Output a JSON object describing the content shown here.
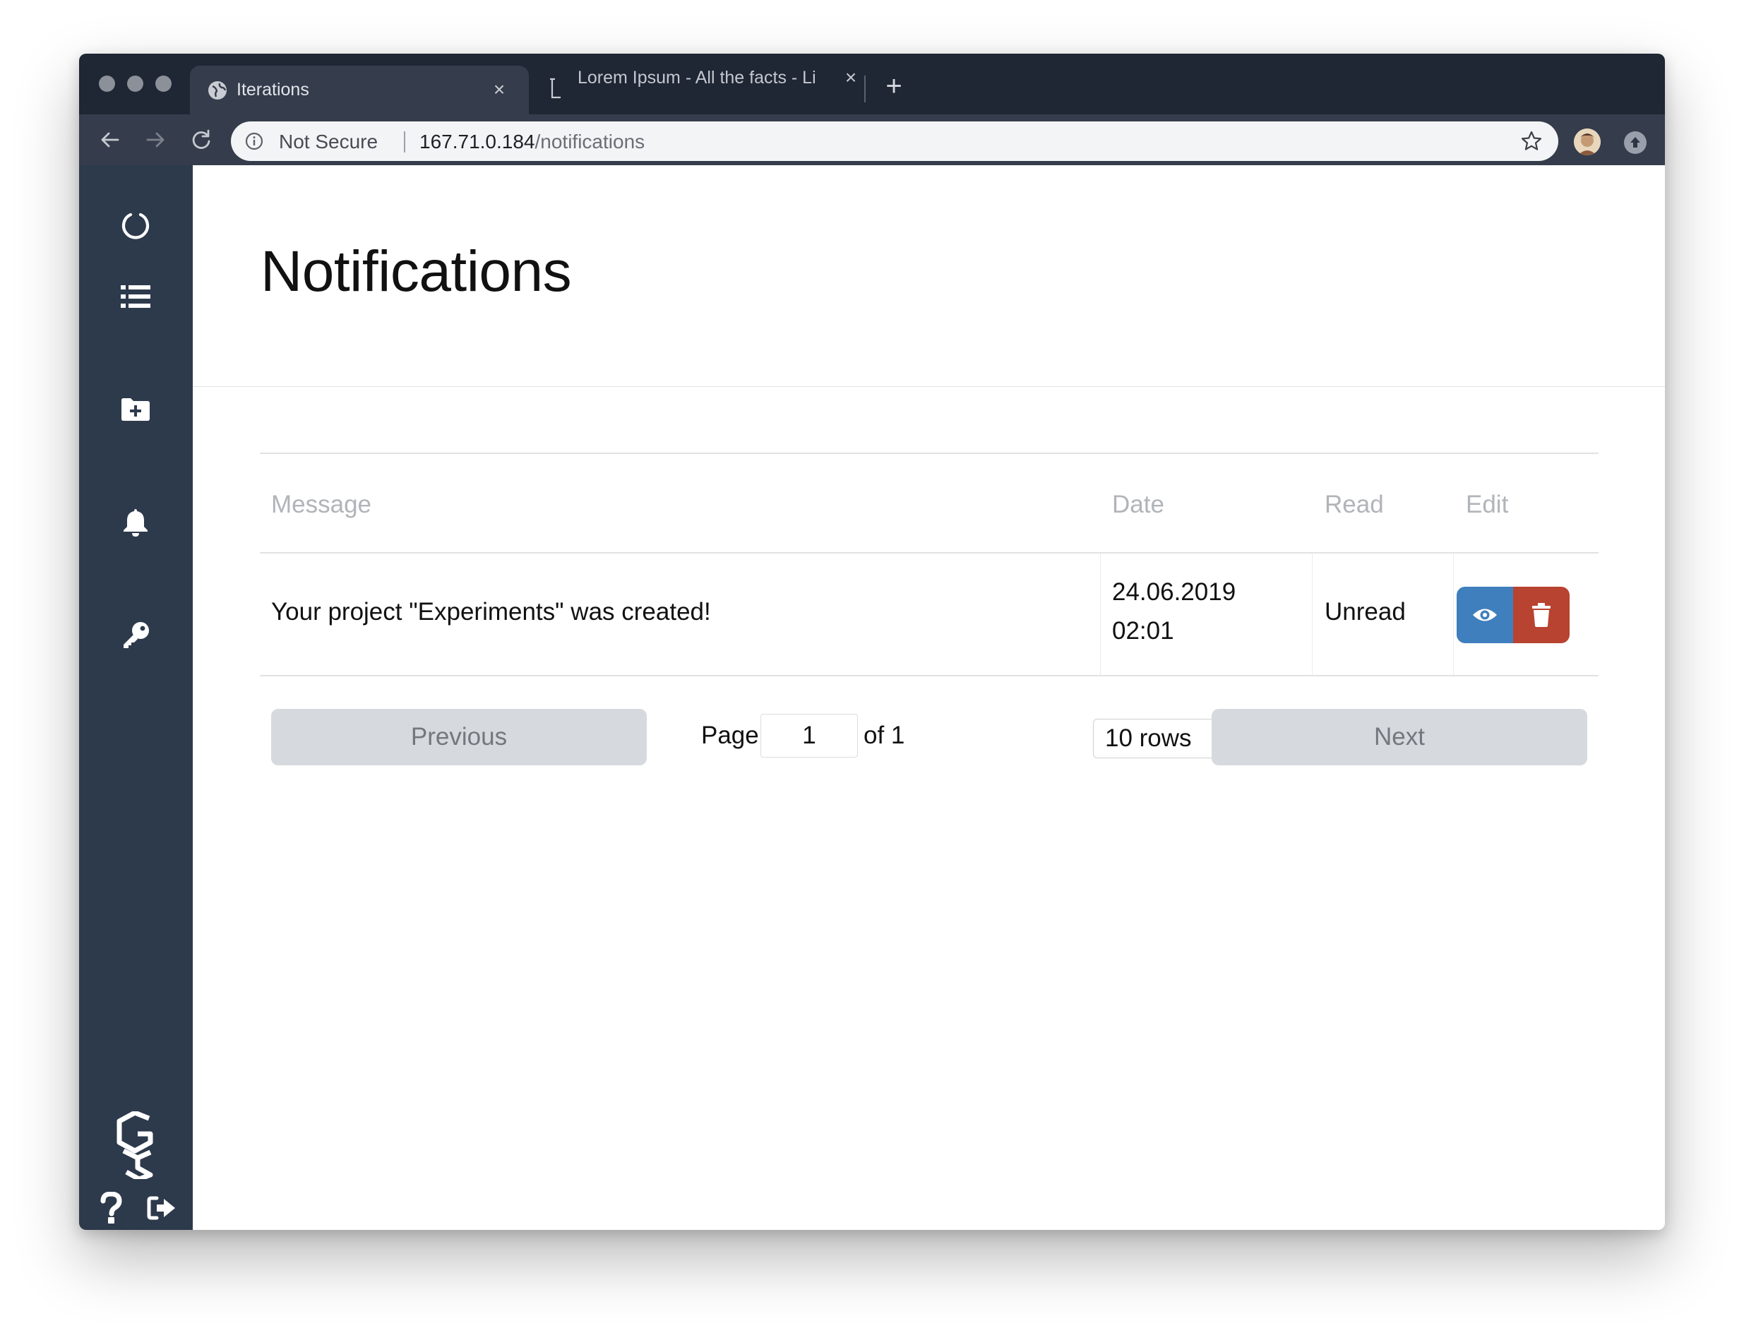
{
  "browser": {
    "tabs": [
      {
        "title": "Iterations",
        "active": true
      },
      {
        "title": "Lorem Ipsum - All the facts - Li",
        "active": false
      }
    ],
    "omnibox": {
      "security_label": "Not Secure",
      "host": "167.71.0.184",
      "path": "/notifications"
    }
  },
  "sidebar": {
    "items": [
      {
        "icon": "circle-notch-icon"
      },
      {
        "icon": "list-icon"
      },
      {
        "icon": "folder-plus-icon"
      },
      {
        "icon": "bell-icon"
      },
      {
        "icon": "key-icon"
      }
    ],
    "bottom": {
      "logo": "brand-logo",
      "help": "question-icon",
      "logout": "sign-out-icon"
    }
  },
  "page": {
    "title": "Notifications"
  },
  "table": {
    "columns": [
      "Message",
      "Date",
      "Read",
      "Edit"
    ],
    "rows": [
      {
        "message": "Your project \"Experiments\" was created!",
        "date": "24.06.2019",
        "time": "02:01",
        "read": "Unread"
      }
    ]
  },
  "pagination": {
    "previous_label": "Previous",
    "page_label": "Page",
    "page_value": "1",
    "of_label": "of 1",
    "rows_select": "10 rows",
    "next_label": "Next"
  },
  "colors": {
    "sidebar": "#2d3a4c",
    "view_button": "#3f7fbe",
    "delete_button": "#b84330",
    "pager_button": "#d6d9dd"
  }
}
